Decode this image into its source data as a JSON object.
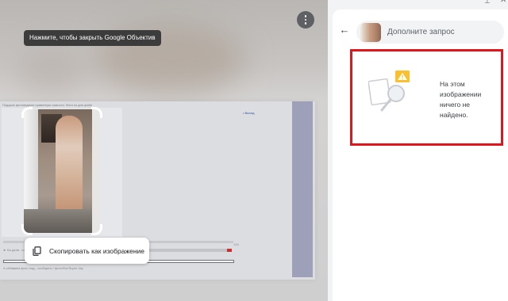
{
  "overlay": {
    "tooltip": "Нажмите, чтобы закрыть Google Объектив",
    "copy_chip_label": "Скопировать как изображение",
    "more_icon": "more-vertical-icon",
    "copy_icon": "copy-icon"
  },
  "page_snapshot": {
    "caption": "Подарок фотоведеню приватную самостя. Фото из дня файл",
    "link_text": "• Выход",
    "footer_line_1": "► Бо дела . со",
    "footer_line_2": "4 отбиваем фото под-, сообщено / фото/бог/Super Jay",
    "page_badge": "124"
  },
  "side_panel": {
    "query_placeholder": "Дополните запрос",
    "back_icon": "arrow-left-icon",
    "pin_icon": "pin-icon",
    "close_icon": "close-icon",
    "no_results_text": "На этом изображении ничего не найдено.",
    "highlight_color": "#e3151b"
  }
}
